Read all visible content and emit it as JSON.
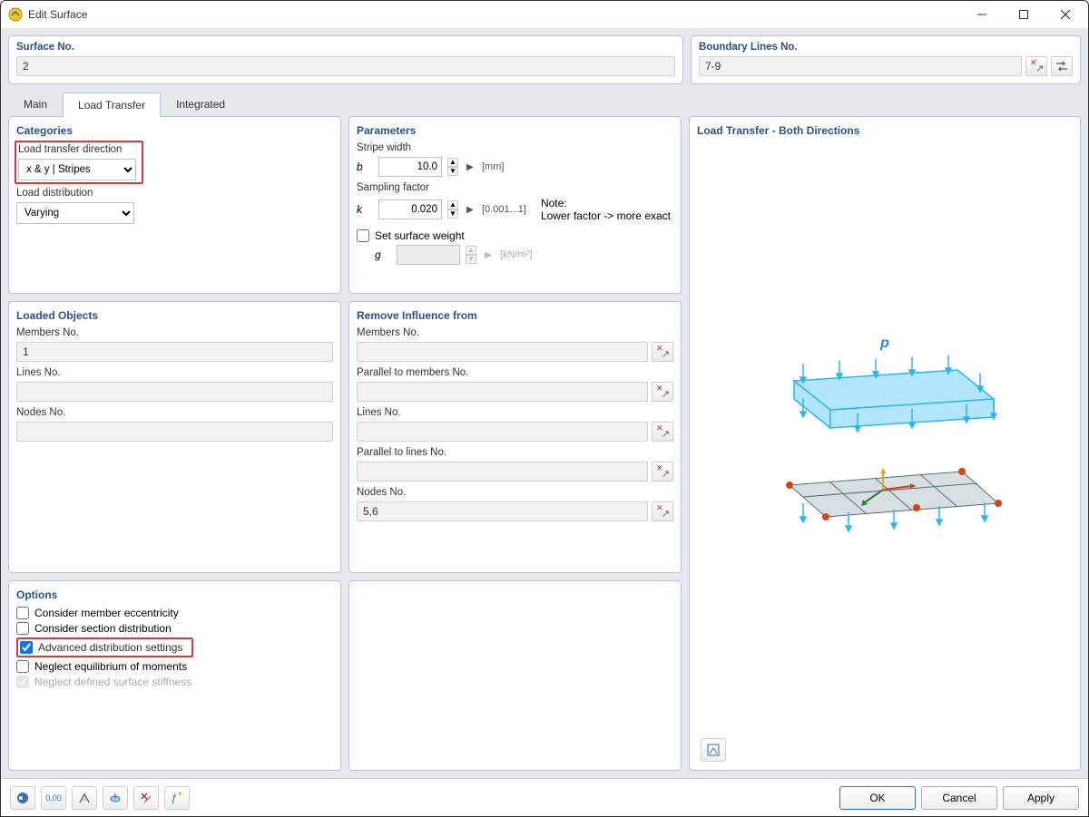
{
  "window": {
    "title": "Edit Surface"
  },
  "header": {
    "surface_no_label": "Surface No.",
    "surface_no_value": "2",
    "boundary_lines_label": "Boundary Lines No.",
    "boundary_lines_value": "7-9"
  },
  "tabs": {
    "main": "Main",
    "load_transfer": "Load Transfer",
    "integrated": "Integrated"
  },
  "categories": {
    "title": "Categories",
    "direction_label": "Load transfer direction",
    "direction_value": "x & y | Stripes",
    "distribution_label": "Load distribution",
    "distribution_value": "Varying"
  },
  "parameters": {
    "title": "Parameters",
    "stripe_width_label": "Stripe width",
    "stripe_width_var": "b",
    "stripe_width_value": "10.0",
    "stripe_width_unit": "[mm]",
    "sampling_factor_label": "Sampling factor",
    "sampling_factor_var": "k",
    "sampling_factor_value": "0.020",
    "sampling_factor_range": "[0.001...1]",
    "note_label": "Note:",
    "note_text": "Lower factor -> more exact",
    "set_surface_weight_label": "Set surface weight",
    "surface_weight_var": "g",
    "surface_weight_value": "",
    "surface_weight_unit": "[kN/m²]"
  },
  "loaded_objects": {
    "title": "Loaded Objects",
    "members_label": "Members No.",
    "members_value": "1",
    "lines_label": "Lines No.",
    "lines_value": "",
    "nodes_label": "Nodes No.",
    "nodes_value": ""
  },
  "remove_influence": {
    "title": "Remove Influence from",
    "members_label": "Members No.",
    "members_value": "",
    "parallel_members_label": "Parallel to members No.",
    "parallel_members_value": "",
    "lines_label": "Lines No.",
    "lines_value": "",
    "parallel_lines_label": "Parallel to lines No.",
    "parallel_lines_value": "",
    "nodes_label": "Nodes No.",
    "nodes_value": "5,6"
  },
  "options": {
    "title": "Options",
    "consider_member_eccentricity": "Consider member eccentricity",
    "consider_section_distribution": "Consider section distribution",
    "advanced_distribution_settings": "Advanced distribution settings",
    "neglect_equilibrium_moments": "Neglect equilibrium of moments",
    "neglect_defined_stiffness": "Neglect defined surface stiffness"
  },
  "preview": {
    "title": "Load Transfer - Both Directions",
    "load_symbol": "p"
  },
  "footer": {
    "ok": "OK",
    "cancel": "Cancel",
    "apply": "Apply"
  }
}
